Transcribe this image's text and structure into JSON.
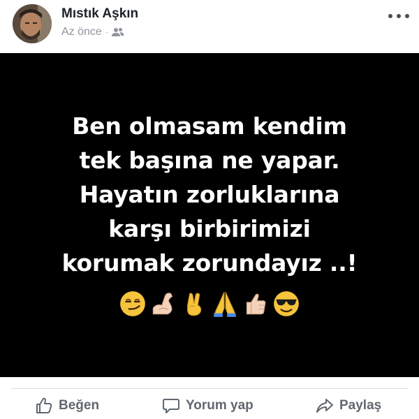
{
  "post": {
    "author": "Mıstık Aşkın",
    "time": "Az önce",
    "separator": "·",
    "audience_icon": "friends-icon",
    "more_icon": "more-horizontal-icon",
    "text_lines": [
      "Ben olmasam kendim",
      "tek başına ne yapar.",
      "Hayatın zorluklarına",
      "karşı birbirimizi",
      "korumak zorundayız ..!"
    ],
    "emojis": [
      "smirking-face",
      "flexed-biceps",
      "victory-hand",
      "folded-hands",
      "thumbs-up",
      "smiling-face-with-sunglasses"
    ],
    "background_color": "#000000"
  },
  "actions": {
    "like_label": "Beğen",
    "comment_label": "Yorum yap",
    "share_label": "Paylaş"
  },
  "colors": {
    "name": "#1d2129",
    "meta": "#90949c",
    "action": "#606770"
  }
}
